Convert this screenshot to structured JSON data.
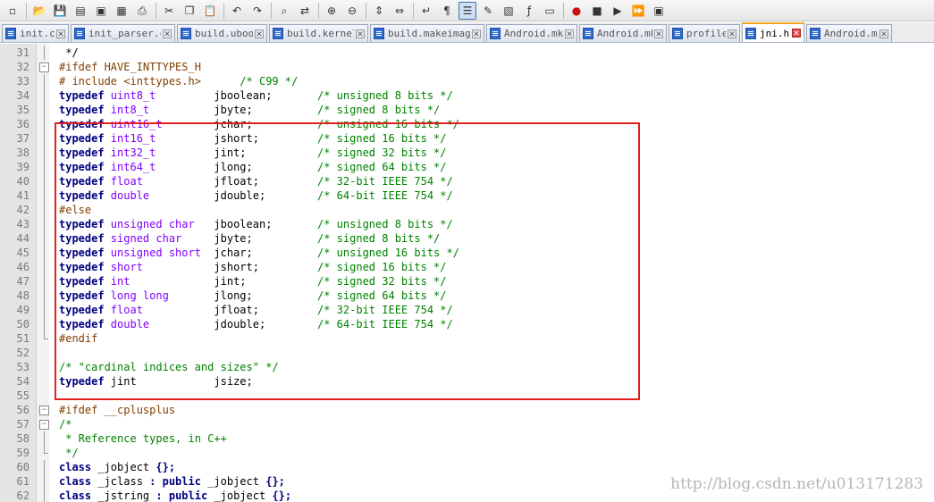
{
  "toolbar": {
    "icons": [
      "new-file-icon",
      "open-file-icon",
      "save-icon",
      "save-all-icon",
      "close-icon",
      "close-all-icon",
      "print-icon",
      "cut-icon",
      "copy-icon",
      "paste-icon",
      "undo-icon",
      "redo-icon",
      "find-icon",
      "replace-icon",
      "zoom-in-icon",
      "zoom-out-icon",
      "sync-v-icon",
      "sync-h-icon",
      "wrap-icon",
      "show-all-chars-icon",
      "indent-guide-icon",
      "udl-icon",
      "doc-map-icon",
      "function-list-icon",
      "folder-workspace-icon",
      "record-macro-icon",
      "stop-macro-icon",
      "play-macro-icon",
      "run-macro-multiple-icon",
      "save-macro-icon"
    ]
  },
  "tabs": [
    {
      "label": "init.c",
      "active": false
    },
    {
      "label": "init_parser.c",
      "active": false
    },
    {
      "label": "build.uboot",
      "active": false
    },
    {
      "label": "build.kernel",
      "active": false
    },
    {
      "label": "build.makeimage",
      "active": false
    },
    {
      "label": "Android.mk",
      "active": false
    },
    {
      "label": "Android.mk",
      "active": false
    },
    {
      "label": "profile",
      "active": false
    },
    {
      "label": "jni.h",
      "active": true
    },
    {
      "label": "Android.mk",
      "active": false
    }
  ],
  "editor": {
    "lines": [
      {
        "n": "31",
        "fold": "vline",
        "segs": [
          [
            "",
            "*/"
          ]
        ],
        "indent": " "
      },
      {
        "n": "32",
        "fold": "box",
        "segs": [
          [
            "pp",
            "#ifdef HAVE_INTTYPES_H"
          ]
        ]
      },
      {
        "n": "33",
        "fold": "vline",
        "segs": [
          [
            "pp",
            "# include <inttypes.h>      "
          ],
          [
            "cm",
            "/* C99 */"
          ]
        ]
      },
      {
        "n": "34",
        "fold": "vline",
        "segs": [
          [
            "kw",
            "typedef "
          ],
          [
            "ty",
            "uint8_t"
          ],
          [
            "",
            "         jboolean;       "
          ],
          [
            "cm",
            "/* unsigned 8 bits */"
          ]
        ]
      },
      {
        "n": "35",
        "fold": "vline",
        "segs": [
          [
            "kw",
            "typedef "
          ],
          [
            "ty",
            "int8_t"
          ],
          [
            "",
            "          jbyte;          "
          ],
          [
            "cm",
            "/* signed 8 bits */"
          ]
        ]
      },
      {
        "n": "36",
        "fold": "vline",
        "segs": [
          [
            "kw",
            "typedef "
          ],
          [
            "ty",
            "uint16_t"
          ],
          [
            "",
            "        jchar;          "
          ],
          [
            "cm",
            "/* unsigned 16 bits */"
          ]
        ]
      },
      {
        "n": "37",
        "fold": "vline",
        "segs": [
          [
            "kw",
            "typedef "
          ],
          [
            "ty",
            "int16_t"
          ],
          [
            "",
            "         jshort;         "
          ],
          [
            "cm",
            "/* signed 16 bits */"
          ]
        ]
      },
      {
        "n": "38",
        "fold": "vline",
        "segs": [
          [
            "kw",
            "typedef "
          ],
          [
            "ty",
            "int32_t"
          ],
          [
            "",
            "         jint;           "
          ],
          [
            "cm",
            "/* signed 32 bits */"
          ]
        ]
      },
      {
        "n": "39",
        "fold": "vline",
        "segs": [
          [
            "kw",
            "typedef "
          ],
          [
            "ty",
            "int64_t"
          ],
          [
            "",
            "         jlong;          "
          ],
          [
            "cm",
            "/* signed 64 bits */"
          ]
        ]
      },
      {
        "n": "40",
        "fold": "vline",
        "segs": [
          [
            "kw",
            "typedef "
          ],
          [
            "ty",
            "float"
          ],
          [
            "",
            "           jfloat;         "
          ],
          [
            "cm",
            "/* 32-bit IEEE 754 */"
          ]
        ]
      },
      {
        "n": "41",
        "fold": "vline",
        "segs": [
          [
            "kw",
            "typedef "
          ],
          [
            "ty",
            "double"
          ],
          [
            "",
            "          jdouble;        "
          ],
          [
            "cm",
            "/* 64-bit IEEE 754 */"
          ]
        ]
      },
      {
        "n": "42",
        "fold": "vline",
        "segs": [
          [
            "pp",
            "#else"
          ]
        ]
      },
      {
        "n": "43",
        "fold": "vline",
        "segs": [
          [
            "kw",
            "typedef "
          ],
          [
            "ty",
            "unsigned char"
          ],
          [
            "",
            "   jboolean;       "
          ],
          [
            "cm",
            "/* unsigned 8 bits */"
          ]
        ]
      },
      {
        "n": "44",
        "fold": "vline",
        "segs": [
          [
            "kw",
            "typedef "
          ],
          [
            "ty",
            "signed char"
          ],
          [
            "",
            "     jbyte;          "
          ],
          [
            "cm",
            "/* signed 8 bits */"
          ]
        ]
      },
      {
        "n": "45",
        "fold": "vline",
        "segs": [
          [
            "kw",
            "typedef "
          ],
          [
            "ty",
            "unsigned short"
          ],
          [
            "",
            "  jchar;          "
          ],
          [
            "cm",
            "/* unsigned 16 bits */"
          ]
        ]
      },
      {
        "n": "46",
        "fold": "vline",
        "segs": [
          [
            "kw",
            "typedef "
          ],
          [
            "ty",
            "short"
          ],
          [
            "",
            "           jshort;         "
          ],
          [
            "cm",
            "/* signed 16 bits */"
          ]
        ]
      },
      {
        "n": "47",
        "fold": "vline",
        "segs": [
          [
            "kw",
            "typedef "
          ],
          [
            "ty",
            "int"
          ],
          [
            "",
            "             jint;           "
          ],
          [
            "cm",
            "/* signed 32 bits */"
          ]
        ]
      },
      {
        "n": "48",
        "fold": "vline",
        "segs": [
          [
            "kw",
            "typedef "
          ],
          [
            "ty",
            "long long"
          ],
          [
            "",
            "       jlong;          "
          ],
          [
            "cm",
            "/* signed 64 bits */"
          ]
        ]
      },
      {
        "n": "49",
        "fold": "vline",
        "segs": [
          [
            "kw",
            "typedef "
          ],
          [
            "ty",
            "float"
          ],
          [
            "",
            "           jfloat;         "
          ],
          [
            "cm",
            "/* 32-bit IEEE 754 */"
          ]
        ]
      },
      {
        "n": "50",
        "fold": "vline",
        "segs": [
          [
            "kw",
            "typedef "
          ],
          [
            "ty",
            "double"
          ],
          [
            "",
            "          jdouble;        "
          ],
          [
            "cm",
            "/* 64-bit IEEE 754 */"
          ]
        ]
      },
      {
        "n": "51",
        "fold": "end",
        "segs": [
          [
            "pp",
            "#endif"
          ]
        ]
      },
      {
        "n": "52",
        "fold": "",
        "segs": []
      },
      {
        "n": "53",
        "fold": "",
        "segs": [
          [
            "cm",
            "/* \"cardinal indices and sizes\" */"
          ]
        ]
      },
      {
        "n": "54",
        "fold": "",
        "segs": [
          [
            "kw",
            "typedef "
          ],
          [
            "",
            "jint            jsize;"
          ]
        ]
      },
      {
        "n": "55",
        "fold": "",
        "segs": []
      },
      {
        "n": "56",
        "fold": "box",
        "segs": [
          [
            "pp",
            "#ifdef __cplusplus"
          ]
        ]
      },
      {
        "n": "57",
        "fold": "box",
        "segs": [
          [
            "cm",
            "/*"
          ]
        ]
      },
      {
        "n": "58",
        "fold": "vline",
        "segs": [
          [
            "cm",
            " * Reference types, in C++"
          ]
        ]
      },
      {
        "n": "59",
        "fold": "end",
        "segs": [
          [
            "cm",
            " */"
          ]
        ]
      },
      {
        "n": "60",
        "fold": "vline",
        "segs": [
          [
            "kw",
            "class "
          ],
          [
            "",
            "_jobject "
          ],
          [
            "op",
            "{};"
          ]
        ]
      },
      {
        "n": "61",
        "fold": "vline",
        "segs": [
          [
            "kw",
            "class "
          ],
          [
            "",
            "_jclass "
          ],
          [
            "op",
            ": "
          ],
          [
            "kw",
            "public "
          ],
          [
            "",
            "_jobject "
          ],
          [
            "op",
            "{};"
          ]
        ]
      },
      {
        "n": "62",
        "fold": "vline",
        "segs": [
          [
            "kw",
            "class "
          ],
          [
            "",
            "_jstring "
          ],
          [
            "op",
            ": "
          ],
          [
            "kw",
            "public "
          ],
          [
            "",
            "_jobject "
          ],
          [
            "op",
            "{};"
          ]
        ]
      }
    ]
  },
  "watermark": "http://blog.csdn.net/u013171283",
  "colors": {
    "keyword": "#000080",
    "type": "#8000ff",
    "comment": "#008000",
    "preprocessor": "#804000",
    "highlight_box": "#e02020"
  }
}
